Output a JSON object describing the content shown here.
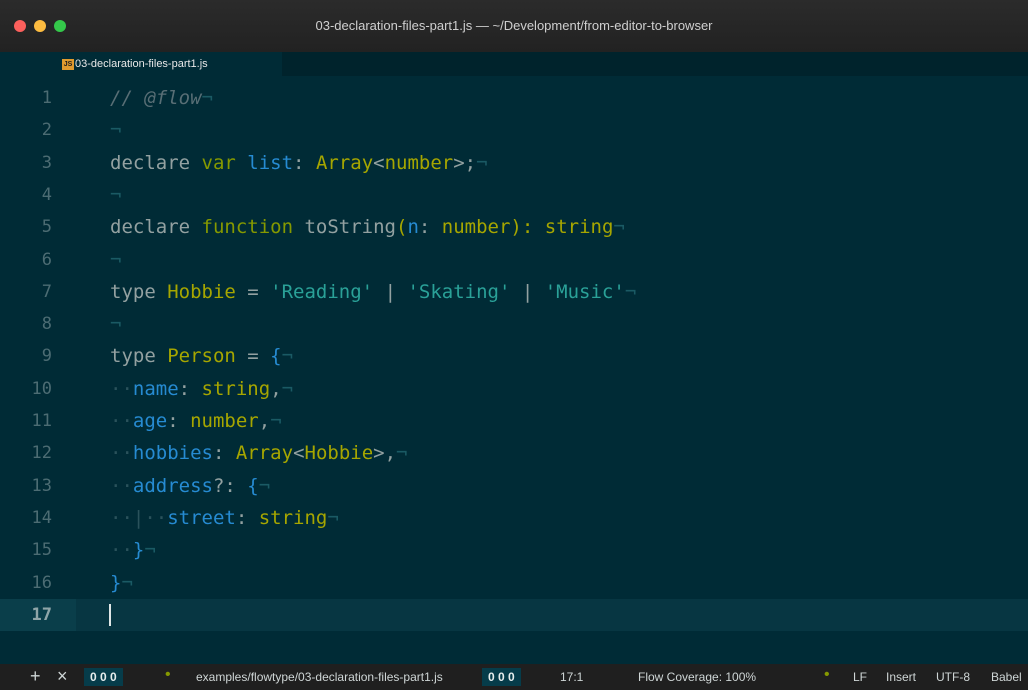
{
  "window": {
    "title": "03-declaration-files-part1.js — ~/Development/from-editor-to-browser"
  },
  "tab": {
    "icon_label": "JS",
    "label": "03-declaration-files-part1.js"
  },
  "editor": {
    "current_line": 17,
    "lines": [
      {
        "n": "1",
        "tokens": [
          {
            "t": "// @flow",
            "c": "cmt"
          },
          {
            "t": "¬",
            "c": "inv"
          }
        ]
      },
      {
        "n": "2",
        "tokens": [
          {
            "t": "¬",
            "c": "inv"
          }
        ]
      },
      {
        "n": "3",
        "tokens": [
          {
            "t": "declare ",
            "c": "kw"
          },
          {
            "t": "var ",
            "c": "kw2"
          },
          {
            "t": "list",
            "c": "fn"
          },
          {
            "t": ": ",
            "c": "op"
          },
          {
            "t": "Array",
            "c": "ty"
          },
          {
            "t": "<",
            "c": "op"
          },
          {
            "t": "number",
            "c": "ty"
          },
          {
            "t": ">;",
            "c": "op"
          },
          {
            "t": "¬",
            "c": "inv"
          }
        ]
      },
      {
        "n": "4",
        "tokens": [
          {
            "t": "¬",
            "c": "inv"
          }
        ]
      },
      {
        "n": "5",
        "tokens": [
          {
            "t": "declare ",
            "c": "kw"
          },
          {
            "t": "function ",
            "c": "kw2"
          },
          {
            "t": "toString",
            "c": "op"
          },
          {
            "t": "(",
            "c": "ty"
          },
          {
            "t": "n",
            "c": "fn"
          },
          {
            "t": ": ",
            "c": "op"
          },
          {
            "t": "number",
            "c": "ty"
          },
          {
            "t": "): ",
            "c": "ty"
          },
          {
            "t": "string",
            "c": "ty"
          },
          {
            "t": "¬",
            "c": "inv"
          }
        ]
      },
      {
        "n": "6",
        "tokens": [
          {
            "t": "¬",
            "c": "inv"
          }
        ]
      },
      {
        "n": "7",
        "tokens": [
          {
            "t": "type ",
            "c": "kw"
          },
          {
            "t": "Hobbie",
            "c": "ty"
          },
          {
            "t": " = ",
            "c": "op"
          },
          {
            "t": "'Reading'",
            "c": "str"
          },
          {
            "t": " | ",
            "c": "op"
          },
          {
            "t": "'Skating'",
            "c": "str"
          },
          {
            "t": " | ",
            "c": "op"
          },
          {
            "t": "'Music'",
            "c": "str"
          },
          {
            "t": "¬",
            "c": "inv"
          }
        ]
      },
      {
        "n": "8",
        "tokens": [
          {
            "t": "¬",
            "c": "inv"
          }
        ]
      },
      {
        "n": "9",
        "tokens": [
          {
            "t": "type ",
            "c": "kw"
          },
          {
            "t": "Person",
            "c": "ty"
          },
          {
            "t": " = ",
            "c": "op"
          },
          {
            "t": "{",
            "c": "brace"
          },
          {
            "t": "¬",
            "c": "inv"
          }
        ]
      },
      {
        "n": "10",
        "tokens": [
          {
            "t": "··",
            "c": "guide"
          },
          {
            "t": "name",
            "c": "prop"
          },
          {
            "t": ": ",
            "c": "op"
          },
          {
            "t": "string",
            "c": "ty"
          },
          {
            "t": ",",
            "c": "op"
          },
          {
            "t": "¬",
            "c": "inv"
          }
        ]
      },
      {
        "n": "11",
        "tokens": [
          {
            "t": "··",
            "c": "guide"
          },
          {
            "t": "age",
            "c": "prop"
          },
          {
            "t": ": ",
            "c": "op"
          },
          {
            "t": "number",
            "c": "ty"
          },
          {
            "t": ",",
            "c": "op"
          },
          {
            "t": "¬",
            "c": "inv"
          }
        ]
      },
      {
        "n": "12",
        "tokens": [
          {
            "t": "··",
            "c": "guide"
          },
          {
            "t": "hobbies",
            "c": "prop"
          },
          {
            "t": ": ",
            "c": "op"
          },
          {
            "t": "Array",
            "c": "ty"
          },
          {
            "t": "<",
            "c": "op"
          },
          {
            "t": "Hobbie",
            "c": "ty"
          },
          {
            "t": ">,",
            "c": "op"
          },
          {
            "t": "¬",
            "c": "inv"
          }
        ]
      },
      {
        "n": "13",
        "tokens": [
          {
            "t": "··",
            "c": "guide"
          },
          {
            "t": "address",
            "c": "prop"
          },
          {
            "t": "?: ",
            "c": "op"
          },
          {
            "t": "{",
            "c": "brace"
          },
          {
            "t": "¬",
            "c": "inv"
          }
        ]
      },
      {
        "n": "14",
        "tokens": [
          {
            "t": "··|··",
            "c": "guide"
          },
          {
            "t": "street",
            "c": "prop"
          },
          {
            "t": ": ",
            "c": "op"
          },
          {
            "t": "string",
            "c": "ty"
          },
          {
            "t": "¬",
            "c": "inv"
          }
        ]
      },
      {
        "n": "15",
        "tokens": [
          {
            "t": "··",
            "c": "guide"
          },
          {
            "t": "}",
            "c": "brace"
          },
          {
            "t": "¬",
            "c": "inv"
          }
        ]
      },
      {
        "n": "16",
        "tokens": [
          {
            "t": "}",
            "c": "brace"
          },
          {
            "t": "¬",
            "c": "inv"
          }
        ]
      },
      {
        "n": "17",
        "tokens": []
      }
    ]
  },
  "statusbar": {
    "add_icon": "+",
    "close_icon": "×",
    "counter_left": "0  0  0",
    "file_path": "examples/flowtype/03-declaration-files-part1.js",
    "counter_mid": "0  0  0",
    "cursor_pos": "17:1",
    "flow_coverage": "Flow Coverage: 100%",
    "line_ending": "LF",
    "mode": "Insert",
    "encoding": "UTF-8",
    "grammar": "Babel"
  },
  "colors": {
    "background": "#002b36",
    "current_line": "#073642",
    "keyword": "#859900",
    "string": "#2aa198",
    "blue": "#268bd2"
  }
}
